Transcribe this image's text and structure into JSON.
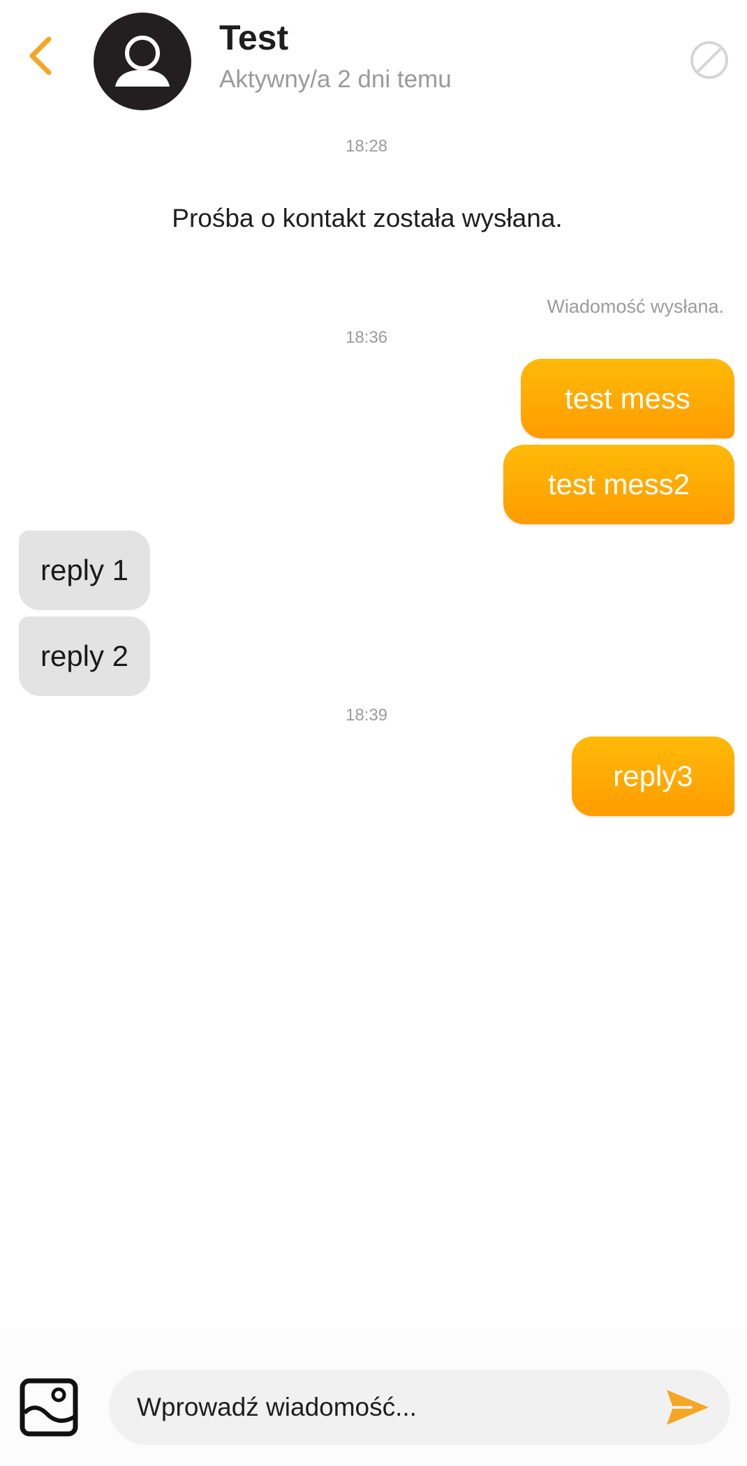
{
  "header": {
    "contact_name": "Test",
    "contact_status": "Aktywny/a 2 dni temu",
    "accent_color": "#F9A825"
  },
  "conversation": {
    "timestamp_1": "18:28",
    "system_notice": "Prośba o kontakt została wysłana.",
    "delivery_status": "Wiadomość wysłana.",
    "timestamp_2": "18:36",
    "timestamp_3": "18:39",
    "messages": [
      {
        "direction": "out",
        "text": "test mess"
      },
      {
        "direction": "out",
        "text": "test mess2"
      },
      {
        "direction": "in",
        "text": "reply 1"
      },
      {
        "direction": "in",
        "text": "reply 2"
      },
      {
        "direction": "out",
        "text": "reply3"
      }
    ],
    "outgoing_bubble_color": "#FFA000",
    "incoming_bubble_color": "#E3E3E3"
  },
  "composer": {
    "placeholder": "Wprowadź wiadomość...",
    "value": "",
    "attach_icon": "image-icon",
    "send_icon": "send-icon"
  }
}
